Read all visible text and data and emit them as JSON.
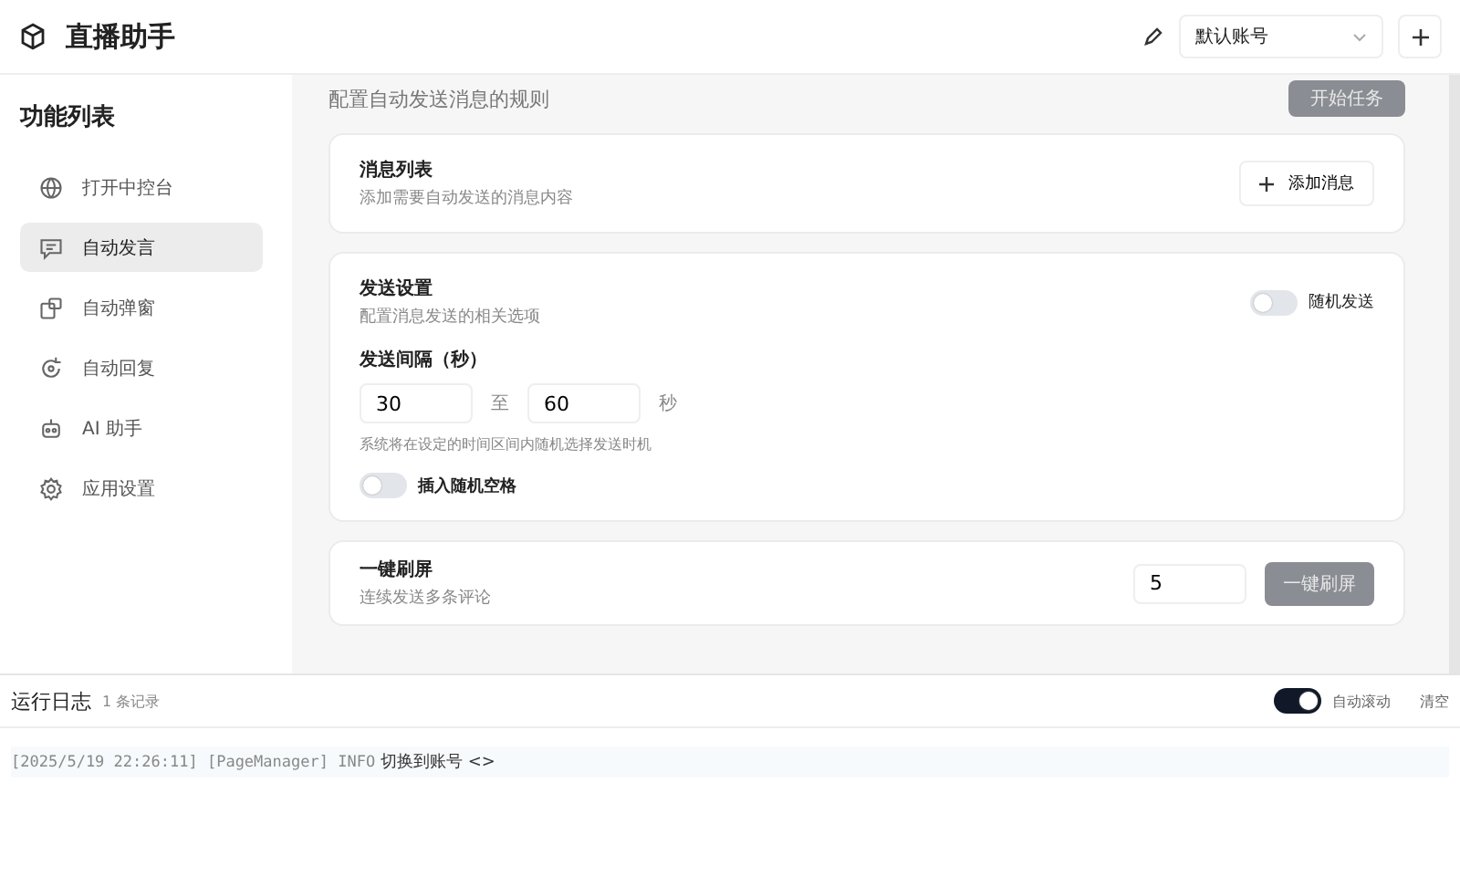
{
  "app": {
    "title": "直播助手"
  },
  "account": {
    "value": "默认账号"
  },
  "sidebar": {
    "title": "功能列表",
    "items": [
      {
        "label": "打开中控台",
        "selected": false
      },
      {
        "label": "自动发言",
        "selected": true
      },
      {
        "label": "自动弹窗",
        "selected": false
      },
      {
        "label": "自动回复",
        "selected": false
      },
      {
        "label": "AI 助手",
        "selected": false
      },
      {
        "label": "应用设置",
        "selected": false
      }
    ]
  },
  "main": {
    "subtitle": "配置自动发送消息的规则",
    "start_button": {
      "label": "开始任务",
      "disabled": true
    },
    "message_list": {
      "title": "消息列表",
      "description": "添加需要自动发送的消息内容",
      "add_button": "添加消息"
    },
    "send_settings": {
      "title": "发送设置",
      "description": "配置消息发送的相关选项",
      "random_send": {
        "label": "随机发送",
        "on": false
      },
      "interval_label": "发送间隔（秒）",
      "min": "30",
      "separator": "至",
      "max": "60",
      "unit": "秒",
      "hint": "系统将在设定的时间区间内随机选择发送时机",
      "random_space": {
        "label": "插入随机空格",
        "on": false
      }
    },
    "refresh": {
      "title": "一键刷屏",
      "description": "连续发送多条评论",
      "count": "5",
      "button": {
        "label": "一键刷屏",
        "disabled": true
      }
    }
  },
  "log": {
    "title": "运行日志",
    "count": "1 条记录",
    "auto_scroll": {
      "label": "自动滚动",
      "on": true
    },
    "clear": "清空",
    "entries": [
      {
        "meta": "[2025/5/19 22:26:11] [PageManager] INFO",
        "message": "切换到账号 <>"
      }
    ]
  }
}
